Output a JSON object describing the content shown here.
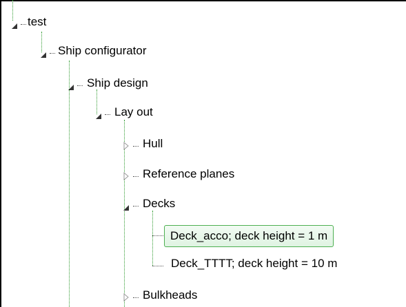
{
  "colors": {
    "connector": "#2e9a2e",
    "selected_border": "#4caf50",
    "selected_fill": "#e6f6e8"
  },
  "tree": {
    "items": [
      {
        "label": "test",
        "state": "expanded",
        "level": 0
      },
      {
        "label": "Ship configurator",
        "state": "expanded",
        "level": 1
      },
      {
        "label": "Ship design",
        "state": "expanded",
        "level": 2
      },
      {
        "label": "Lay out",
        "state": "expanded",
        "level": 3
      },
      {
        "label": "Hull",
        "state": "collapsed",
        "level": 4
      },
      {
        "label": "Reference planes",
        "state": "collapsed",
        "level": 4
      },
      {
        "label": "Decks",
        "state": "expanded",
        "level": 4
      },
      {
        "label": "Deck_acco; deck height = 1 m",
        "state": "leaf",
        "level": 5,
        "selected": true
      },
      {
        "label": "Deck_TTTT; deck height = 10 m",
        "state": "leaf",
        "level": 5
      },
      {
        "label": "Bulkheads",
        "state": "collapsed",
        "level": 4
      }
    ]
  }
}
